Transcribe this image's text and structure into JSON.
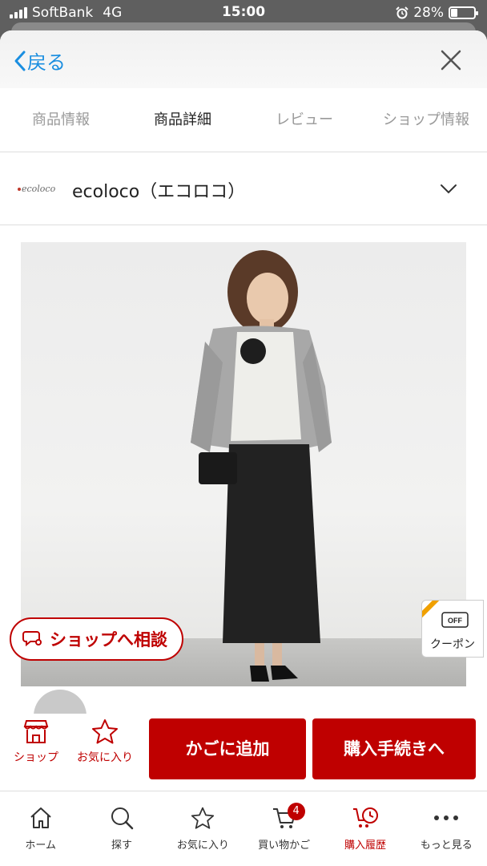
{
  "status_bar": {
    "carrier": "SoftBank",
    "network": "4G",
    "time": "15:00",
    "battery": "28%",
    "battery_level": 0.28
  },
  "nav": {
    "back_label": "戻る"
  },
  "tabs": [
    {
      "label": "商品情報",
      "active": false
    },
    {
      "label": "商品詳細",
      "active": true
    },
    {
      "label": "レビュー",
      "active": false
    },
    {
      "label": "ショップ情報",
      "active": false
    }
  ],
  "shop": {
    "logo_text": "ecoloco",
    "name": "ecoloco（エコロコ）"
  },
  "consult_button": {
    "label": "ショップへ相談"
  },
  "coupon": {
    "badge": "OFF",
    "label": "クーポン"
  },
  "actions": {
    "shop_label": "ショップ",
    "favorite_label": "お気に入り",
    "add_to_cart": "かごに追加",
    "checkout": "購入手続きへ"
  },
  "tabbar": {
    "items": [
      {
        "label": "ホーム",
        "icon": "home-icon"
      },
      {
        "label": "探す",
        "icon": "search-icon"
      },
      {
        "label": "お気に入り",
        "icon": "star-icon"
      },
      {
        "label": "買い物かご",
        "icon": "cart-icon",
        "badge": "4"
      },
      {
        "label": "購入履歴",
        "icon": "history-icon",
        "active": true
      },
      {
        "label": "もっと見る",
        "icon": "more-icon"
      }
    ]
  },
  "colors": {
    "accent": "#bf0000",
    "link": "#1a8ee0",
    "coupon_stripe": "#f0a000"
  }
}
